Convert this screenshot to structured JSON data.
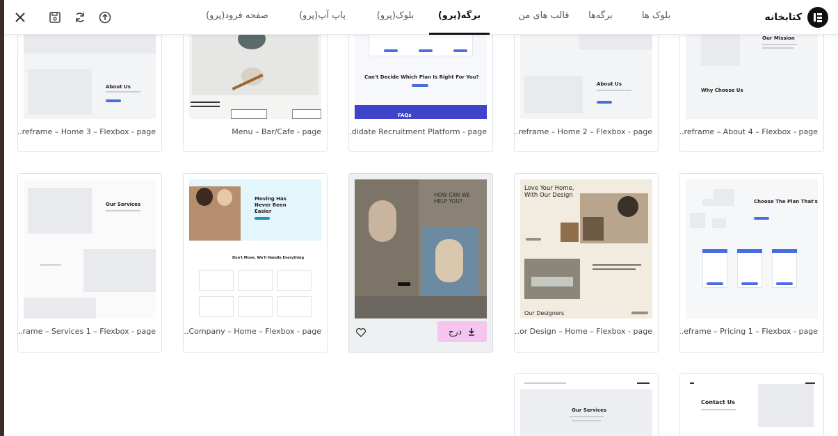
{
  "header": {
    "logo_text": "کتابخانه",
    "tabs": [
      {
        "label": "بلوک ها"
      },
      {
        "label": "برگه‌ها"
      },
      {
        "label": "قالب های من"
      },
      {
        "label": "برگه(پرو)"
      },
      {
        "label": "بلوک(پرو)"
      },
      {
        "label": "پاپ آپ(پرو)"
      },
      {
        "label": "صفحه فرود(پرو)"
      }
    ],
    "active_tab": "برگه(پرو)",
    "tool_icons": [
      "upload-icon",
      "sync-icon",
      "save-icon",
      "close-icon"
    ]
  },
  "cards": [
    {
      "title": "...reframe – About 4 – Flexbox - page",
      "thumb_text": [
        "Our Mission",
        "Why Choose Us"
      ]
    },
    {
      "title": "...reframe – Home 2 – Flexbox - page",
      "thumb_text": [
        "About Us"
      ]
    },
    {
      "title": "...didate Recruitment Platform - page",
      "thumb_text": [
        "Can't Decide Which Plan Is Right For You?",
        "FAQs"
      ]
    },
    {
      "title": "Menu – Bar/Cafe - page",
      "thumb_text": []
    },
    {
      "title": "...reframe – Home 3 – Flexbox - page",
      "thumb_text": [
        "About Us"
      ]
    },
    {
      "title": "...eframe – Pricing 1 – Flexbox - page",
      "thumb_text": [
        "Choose The Plan That's Right For You."
      ]
    },
    {
      "title": "...or Design – Home – Flexbox - page",
      "thumb_text": [
        "Love Your Home, With Our Design",
        "Our Designers"
      ]
    },
    {
      "title": "",
      "thumb_text": [
        "HOW CAN WE HELP YOU?"
      ],
      "insert_label": "درج"
    },
    {
      "title": "...Company – Home – Flexbox - page",
      "thumb_text": [
        "Moving Has Never Been Easier",
        "Don't Move, We'll Handle Everything"
      ]
    },
    {
      "title": "...rame – Services 1 – Flexbox - page",
      "thumb_text": [
        "Our Services"
      ]
    },
    {
      "title": "",
      "thumb_text": [
        "Contact Us"
      ]
    },
    {
      "title": "",
      "thumb_text": [
        "Our Services"
      ]
    }
  ],
  "colors": {
    "accent": "#4a6ee0",
    "insert_button": "#f3c5ef",
    "active_tab": "#111111"
  }
}
